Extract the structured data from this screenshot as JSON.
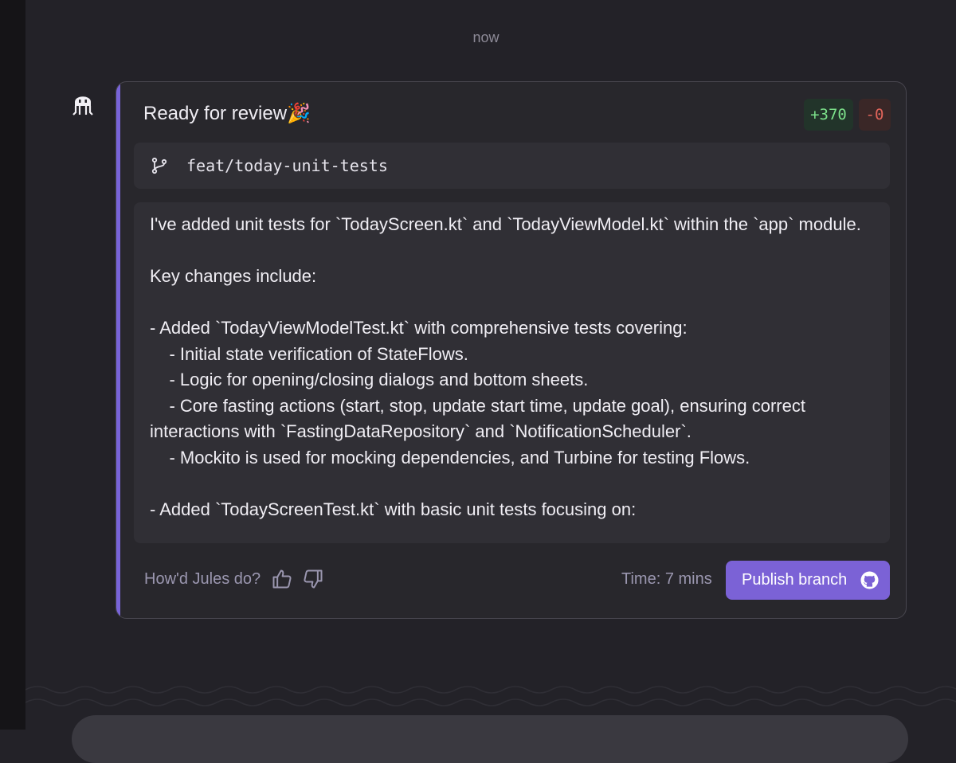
{
  "timestamp": "now",
  "avatar_icon": "octopus-icon",
  "card": {
    "title": "Ready for review",
    "title_emoji": "🎉",
    "additions": "+370",
    "deletions": "-0",
    "branch_icon": "git-branch-icon",
    "branch_name": "feat/today-unit-tests",
    "message": "I've added unit tests for `TodayScreen.kt` and `TodayViewModel.kt` within the `app` module.\n\nKey changes include:\n\n- Added `TodayViewModelTest.kt` with comprehensive tests covering:\n    - Initial state verification of StateFlows.\n    - Logic for opening/closing dialogs and bottom sheets.\n    - Core fasting actions (start, stop, update start time, update goal), ensuring correct interactions with `FastingDataRepository` and `NotificationScheduler`.\n    - Mockito is used for mocking dependencies, and Turbine for testing Flows.\n\n- Added `TodayScreenTest.kt` with basic unit tests focusing on:"
  },
  "footer": {
    "feedback_question": "How'd Jules do?",
    "thumbs_up_icon": "thumbs-up-icon",
    "thumbs_down_icon": "thumbs-down-icon",
    "time_label": "Time: 7 mins",
    "publish_label": "Publish branch",
    "publish_icon": "github-icon"
  },
  "colors": {
    "accent": "#7b62d6",
    "additions": "#7ce08a",
    "deletions": "#e0645a"
  }
}
